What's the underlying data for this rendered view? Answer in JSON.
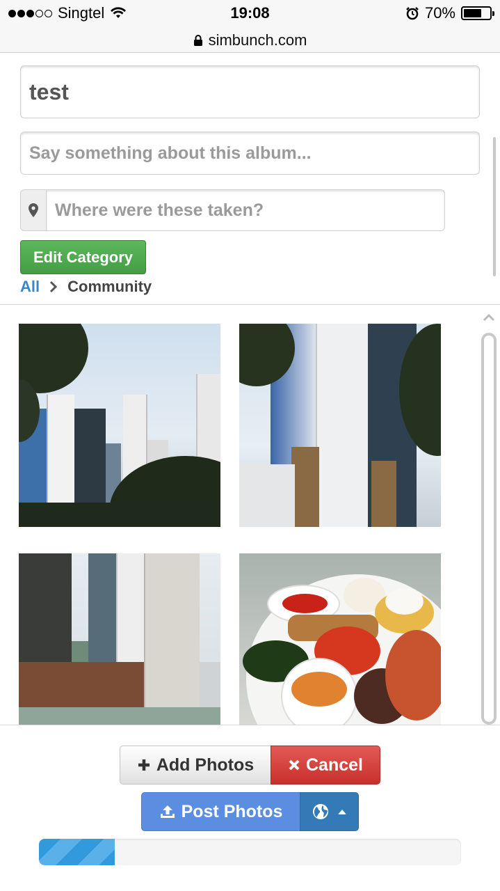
{
  "status_bar": {
    "carrier": "Singtel",
    "time": "19:08",
    "battery_percent": "70%",
    "battery_level": 0.7
  },
  "url_bar": {
    "domain": "simbunch.com"
  },
  "album_form": {
    "title_value": "test",
    "description_placeholder": "Say something about this album...",
    "location_placeholder": "Where were these taken?",
    "edit_category_label": "Edit Category",
    "breadcrumb": {
      "root": "All",
      "current": "Community"
    }
  },
  "actions": {
    "add_photos_label": "Add Photos",
    "cancel_label": "Cancel",
    "post_photos_label": "Post Photos",
    "upload_progress": 0.18
  },
  "colors": {
    "green": "#5cb85c",
    "red": "#d9534f",
    "blue": "#5b8ee0",
    "link": "#3a87c8"
  }
}
